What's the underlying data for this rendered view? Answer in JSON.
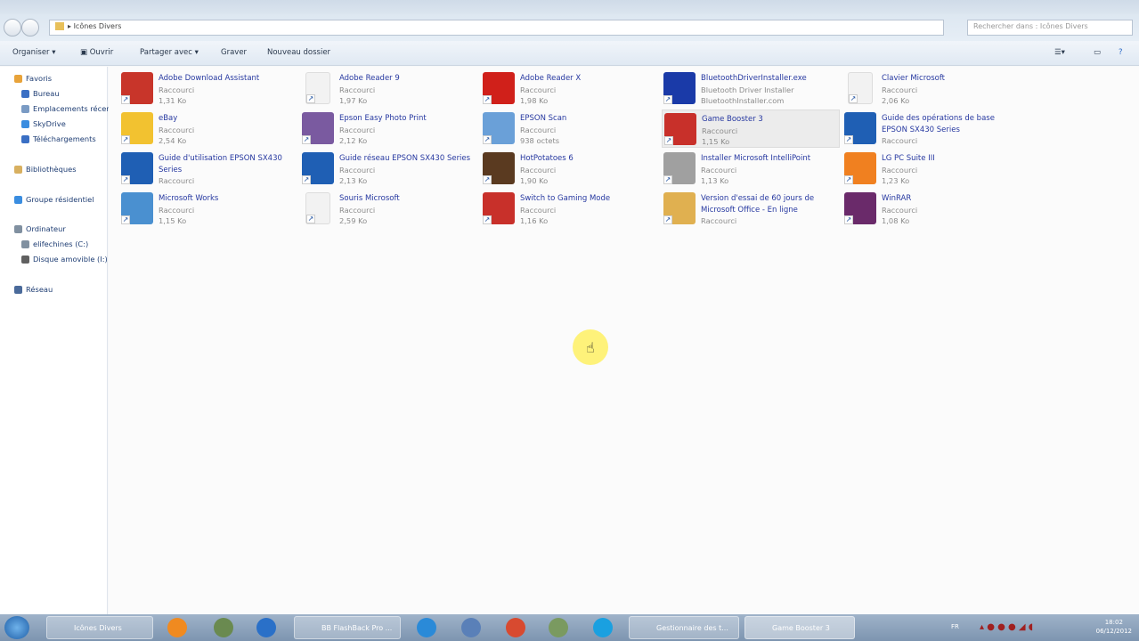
{
  "address": {
    "path": "Icônes Divers",
    "search_placeholder": "Rechercher dans : Icônes Divers"
  },
  "toolbar": {
    "organize": "Organiser ▾",
    "open": "Ouvrir",
    "share": "Partager avec ▾",
    "burn": "Graver",
    "new_folder": "Nouveau dossier"
  },
  "sidebar": [
    {
      "label": "Favoris",
      "color": "#e8a33a"
    },
    {
      "label": "Bureau",
      "color": "#3a6fc4"
    },
    {
      "label": "Emplacements récents",
      "color": "#7a9bc4"
    },
    {
      "label": "SkyDrive",
      "color": "#3a8de0"
    },
    {
      "label": "Téléchargements",
      "color": "#3a6fc4"
    },
    {
      "label": "Bibliothèques",
      "color": "#d8b060"
    },
    {
      "label": "Groupe résidentiel",
      "color": "#3a8de0"
    },
    {
      "label": "Ordinateur",
      "color": "#8090a0"
    },
    {
      "label": "elifechines (C:)",
      "color": "#8090a0"
    },
    {
      "label": "Disque amovible (I:)",
      "color": "#606060"
    },
    {
      "label": "Réseau",
      "color": "#4a6a9a"
    }
  ],
  "items": [
    {
      "name": "Adobe Download Assistant",
      "l2": "Raccourci",
      "l3": "1,31 Ko",
      "color": "#c8352a"
    },
    {
      "name": "eBay",
      "l2": "Raccourci",
      "l3": "2,54 Ko",
      "color": "#f2c230"
    },
    {
      "name": "Guide d'utilisation EPSON SX430 Series",
      "l2": "Raccourci",
      "l3": "",
      "color": "#1f5fb4"
    },
    {
      "name": "Microsoft Works",
      "l2": "Raccourci",
      "l3": "1,15 Ko",
      "color": "#4a90d0"
    },
    {
      "name": "Adobe Reader 9",
      "l2": "Raccourci",
      "l3": "1,97 Ko",
      "color": "#f2f2f2"
    },
    {
      "name": "Epson Easy Photo Print",
      "l2": "Raccourci",
      "l3": "2,12 Ko",
      "color": "#7a5aa0"
    },
    {
      "name": "Guide réseau EPSON SX430 Series",
      "l2": "Raccourci",
      "l3": "2,13 Ko",
      "color": "#1f5fb4"
    },
    {
      "name": "Souris Microsoft",
      "l2": "Raccourci",
      "l3": "2,59 Ko",
      "color": "#f2f2f2"
    },
    {
      "name": "Adobe Reader X",
      "l2": "Raccourci",
      "l3": "1,98 Ko",
      "color": "#d0201a"
    },
    {
      "name": "EPSON Scan",
      "l2": "Raccourci",
      "l3": "938 octets",
      "color": "#6aa0d8"
    },
    {
      "name": "HotPotatoes 6",
      "l2": "Raccourci",
      "l3": "1,90 Ko",
      "color": "#5a3a20"
    },
    {
      "name": "Switch to Gaming Mode",
      "l2": "Raccourci",
      "l3": "1,16 Ko",
      "color": "#c8302a"
    },
    {
      "name": "BluetoothDriverInstaller.exe",
      "l2": "Bluetooth Driver Installer",
      "l3": "BluetoothInstaller.com",
      "color": "#1a3aa8"
    },
    {
      "name": "Game Booster 3",
      "l2": "Raccourci",
      "l3": "1,15 Ko",
      "color": "#c8302a"
    },
    {
      "name": "Installer Microsoft IntelliPoint",
      "l2": "Raccourci",
      "l3": "1,13 Ko",
      "color": "#a0a0a0"
    },
    {
      "name": "Version d'essai de 60 jours de Microsoft Office - En ligne",
      "l2": "Raccourci",
      "l3": "",
      "color": "#e0b050"
    },
    {
      "name": "Clavier Microsoft",
      "l2": "Raccourci",
      "l3": "2,06 Ko",
      "color": "#f2f2f2"
    },
    {
      "name": "Guide des opérations de base EPSON SX430 Series",
      "l2": "Raccourci",
      "l3": "",
      "color": "#1f5fb4"
    },
    {
      "name": "LG PC Suite III",
      "l2": "Raccourci",
      "l3": "1,23 Ko",
      "color": "#f08020"
    },
    {
      "name": "WinRAR",
      "l2": "Raccourci",
      "l3": "1,08 Ko",
      "color": "#6a2a6a"
    }
  ],
  "taskbar": {
    "tasks": [
      "Icônes Divers",
      "BB FlashBack Pro ...",
      "Gestionnaire des t...",
      "Game Booster 3"
    ],
    "clock_time": "18:02",
    "clock_date": "06/12/2012",
    "lang": "FR"
  }
}
